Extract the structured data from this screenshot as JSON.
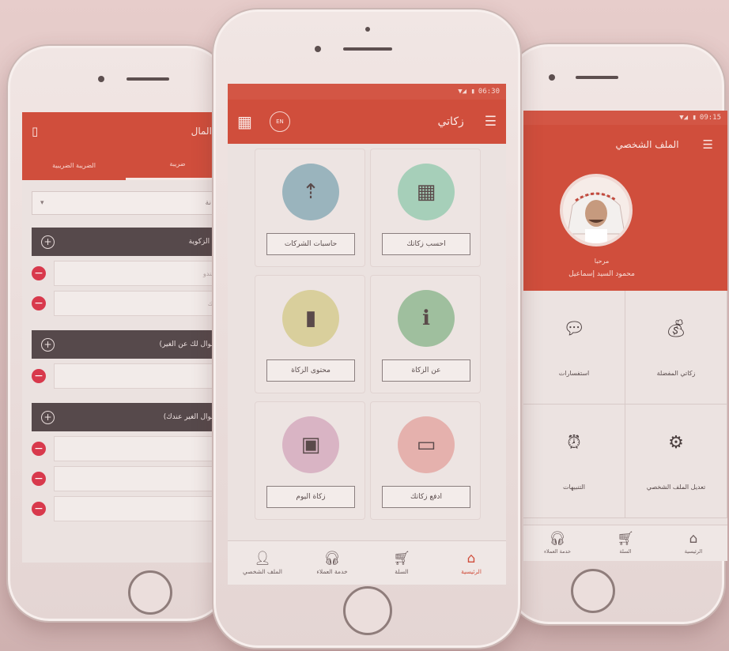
{
  "center": {
    "status": {
      "time": "06:30",
      "signal": "▼◢ ▮"
    },
    "title": "زكاتي",
    "icons": {
      "menu": "hamburger-icon",
      "lang": "language-icon",
      "grid": "calculator-icon"
    },
    "lang_label": "EN",
    "tiles": [
      {
        "label": "احسب زكاتك",
        "icon": "calculator-grid-icon",
        "color": "#a6cfb9"
      },
      {
        "label": "حاسبات الشركات",
        "icon": "upload-arrow-icon",
        "color": "#9ab4bd"
      },
      {
        "label": "عن الزكاة",
        "icon": "info-icon",
        "color": "#9fbf9e"
      },
      {
        "label": "محتوى الزكاة",
        "icon": "book-icon",
        "color": "#d9cf9c"
      },
      {
        "label": "ادفع زكاتك",
        "icon": "payment-card-icon",
        "color": "#e5b1ad"
      },
      {
        "label": "زكاة اليوم",
        "icon": "image-frame-icon",
        "color": "#d9b4c4"
      }
    ],
    "nav": [
      {
        "label": "الرئيسية",
        "icon": "home-icon",
        "active": true
      },
      {
        "label": "السلة",
        "icon": "cart-icon",
        "active": false
      },
      {
        "label": "خدمة العملاء",
        "icon": "headset-icon",
        "active": false
      },
      {
        "label": "الملف الشخصي",
        "icon": "user-icon",
        "active": false
      }
    ]
  },
  "left": {
    "title": "ة المال",
    "tabs": [
      "ضريبة",
      "الضريبة الضريبية"
    ],
    "select_value": "نة",
    "sections": [
      {
        "title": "ني الزكوية",
        "fields": [
          "الصندو",
          "البنك"
        ]
      },
      {
        "title": "(أموال لك عن الغير)",
        "fields": [
          "عن"
        ]
      },
      {
        "title": "(أموال الغير عندك)",
        "fields": [
          "عند",
          "",
          ""
        ]
      }
    ]
  },
  "right": {
    "status": {
      "time": "09:15"
    },
    "title": "الملف الشخصي",
    "greeting": "مرحبا",
    "user_name": "محمود السيد إسماعيل",
    "cells": [
      {
        "label": "زكاتي المفضلة",
        "icon": "money-bag-icon"
      },
      {
        "label": "استفسارات",
        "icon": "chat-bubble-icon"
      },
      {
        "label": "تعديل الملف الشخصي",
        "icon": "gear-icon"
      },
      {
        "label": "التنبيهات",
        "icon": "alarm-clock-icon"
      }
    ],
    "nav": [
      {
        "label": "الرئيسية",
        "icon": "home-icon"
      },
      {
        "label": "السلة",
        "icon": "cart-icon"
      },
      {
        "label": "خدمة العملاء",
        "icon": "headset-icon"
      }
    ]
  }
}
